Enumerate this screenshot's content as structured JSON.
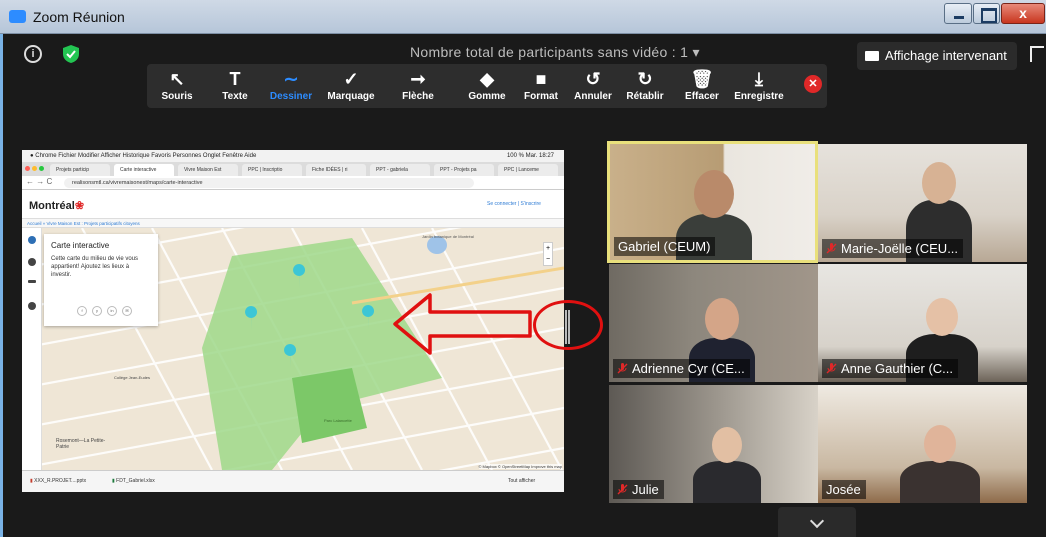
{
  "window": {
    "title": "Zoom Réunion",
    "close_glyph": "x"
  },
  "meeting": {
    "participants_info": "Nombre total de participants sans vidéo : 1",
    "speaker_view_label": "Affichage intervenant"
  },
  "toolbar": {
    "tools": [
      {
        "label": "Souris",
        "glyph": "↖",
        "icon": "mouse-pointer-icon"
      },
      {
        "label": "Texte",
        "glyph": "T",
        "icon": "text-icon"
      },
      {
        "label": "Dessiner",
        "glyph": "∼",
        "icon": "draw-icon",
        "active": true
      },
      {
        "label": "Marquage",
        "glyph": "✓",
        "icon": "stamp-icon"
      },
      {
        "label": "Flèche",
        "glyph": "➞",
        "icon": "arrow-icon"
      },
      {
        "label": "Gomme",
        "glyph": "◆",
        "icon": "eraser-icon"
      },
      {
        "label": "Format",
        "glyph": "■",
        "icon": "format-icon"
      },
      {
        "label": "Annuler",
        "glyph": "↺",
        "icon": "undo-icon"
      },
      {
        "label": "Rétablir",
        "glyph": "↻",
        "icon": "redo-icon"
      },
      {
        "label": "Effacer",
        "glyph": "🗑",
        "icon": "clear-icon"
      },
      {
        "label": "Enregistre",
        "glyph": "⤓",
        "icon": "save-icon"
      }
    ],
    "close_glyph": "✕"
  },
  "shared_screen": {
    "mac_menu": "Chrome   Fichier   Modifier   Afficher   Historique   Favoris   Personnes   Onglet   Fenêtre   Aide",
    "mac_status": "100 %   Mar. 18:27",
    "tabs": [
      "Projets particip",
      "Carte interactive",
      "Vivre Maison Est",
      "PPC | Inscriptio",
      "Fiche IDÉES | ri",
      "PPT - gabriela",
      "PPT - Projets pa",
      "PPC | Lanceme"
    ],
    "url": "realisonsmtl.ca/vivremaisonest/maps/carte-interactive",
    "logo": "Montréal",
    "logo_mark": "❀",
    "login": "Se connecter  |  S'inscrire",
    "breadcrumb": "Accueil  »  Vivre Maison Est : Projets participatifs citoyens",
    "card_title": "Carte interactive",
    "card_text": "Cette carte du milieu de vie vous appartient! Ajoutez les lieux à investir.",
    "social": [
      "f",
      "y",
      "in",
      "✉"
    ],
    "zoom_in": "+",
    "zoom_out": "−",
    "map_labels": [
      "Jardin botanique de Montréal",
      "Parc Lalancette",
      "Rosemont—La Petite-Patrie",
      "Collège Jean-Eudes"
    ],
    "attribution": "© Mapbox © OpenStreetMap Improve this map",
    "downloads": [
      "XXX_R.PROJET....pptx",
      "FDT_Gabriel.xlsx"
    ],
    "show_all": "Tout afficher"
  },
  "participants": [
    {
      "name": "Gabriel (CEUM)",
      "muted": false,
      "active": true
    },
    {
      "name": "Marie-Joëlle (CEU...",
      "muted": true
    },
    {
      "name": "Adrienne Cyr (CE...",
      "muted": true
    },
    {
      "name": "Anne Gauthier (C...",
      "muted": true
    },
    {
      "name": "Julie",
      "muted": true
    },
    {
      "name": "Josée",
      "muted": false
    }
  ],
  "colors": {
    "accent": "#2d8cff",
    "annotation": "#e01010",
    "active_speaker": "#e9e07c",
    "map_green": "#9fd88a"
  }
}
